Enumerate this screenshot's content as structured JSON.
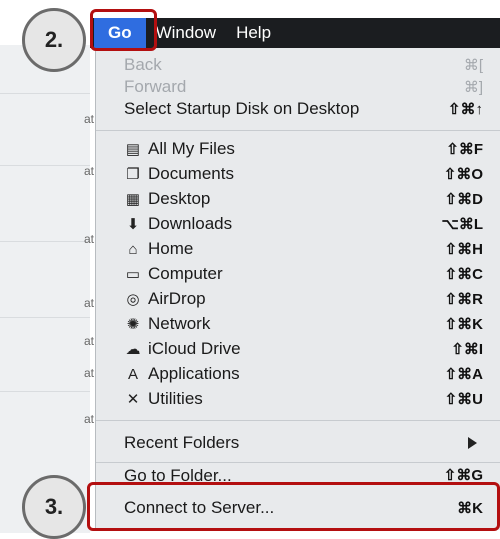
{
  "callouts": {
    "step2": "2.",
    "step3": "3."
  },
  "menubar": {
    "go": "Go",
    "window": "Window",
    "help": "Help"
  },
  "background_fragments": [
    "at",
    "at",
    "at",
    "at",
    "at",
    "at",
    "at"
  ],
  "menu": {
    "back": {
      "label": "Back",
      "shortcut": "⌘["
    },
    "forward": {
      "label": "Forward",
      "shortcut": "⌘]"
    },
    "startup": {
      "label": "Select Startup Disk on Desktop",
      "shortcut": "⇧⌘↑"
    },
    "all_my_files": {
      "label": "All My Files",
      "shortcut": "⇧⌘F",
      "icon": "all-files-icon"
    },
    "documents": {
      "label": "Documents",
      "shortcut": "⇧⌘O",
      "icon": "documents-icon"
    },
    "desktop": {
      "label": "Desktop",
      "shortcut": "⇧⌘D",
      "icon": "desktop-icon"
    },
    "downloads": {
      "label": "Downloads",
      "shortcut": "⌥⌘L",
      "icon": "downloads-icon"
    },
    "home": {
      "label": "Home",
      "shortcut": "⇧⌘H",
      "icon": "home-icon"
    },
    "computer": {
      "label": "Computer",
      "shortcut": "⇧⌘C",
      "icon": "computer-icon"
    },
    "airdrop": {
      "label": "AirDrop",
      "shortcut": "⇧⌘R",
      "icon": "airdrop-icon"
    },
    "network": {
      "label": "Network",
      "shortcut": "⇧⌘K",
      "icon": "network-icon"
    },
    "icloud": {
      "label": "iCloud Drive",
      "shortcut": "⇧⌘I",
      "icon": "icloud-icon"
    },
    "applications": {
      "label": "Applications",
      "shortcut": "⇧⌘A",
      "icon": "applications-icon"
    },
    "utilities": {
      "label": "Utilities",
      "shortcut": "⇧⌘U",
      "icon": "utilities-icon"
    },
    "recent_folders": {
      "label": "Recent Folders"
    },
    "go_to_folder": {
      "label": "Go to Folder...",
      "shortcut": "⇧⌘G"
    },
    "connect": {
      "label": "Connect to Server...",
      "shortcut": "⌘K"
    }
  },
  "colors": {
    "menubar": "#1b1d20",
    "highlight": "#2f6de0",
    "callout_border": "#b30f10"
  }
}
